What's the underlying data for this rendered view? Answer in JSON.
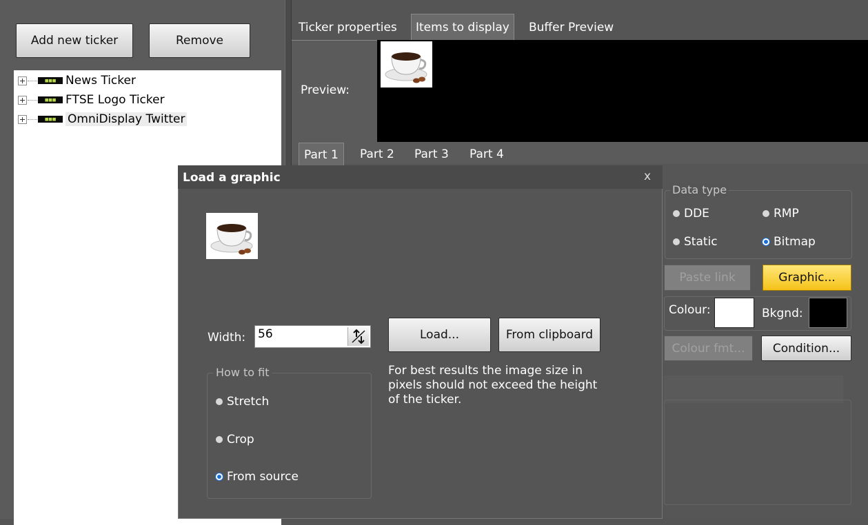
{
  "left_pane": {
    "add_button": "Add new ticker",
    "remove_button": "Remove",
    "tree_items": [
      {
        "label": "News Ticker"
      },
      {
        "label": "FTSE Logo Ticker"
      },
      {
        "label": "OmniDisplay Twitter"
      }
    ]
  },
  "tabs": [
    "Ticker properties",
    "Items to display",
    "Buffer Preview"
  ],
  "preview": {
    "label": "Preview:"
  },
  "parts": [
    "Part 1",
    "Part 2",
    "Part 3",
    "Part 4"
  ],
  "properties": {
    "data_type_legend": "Data type",
    "radios": [
      "DDE",
      "RMP",
      "Static",
      "Bitmap"
    ],
    "paste_link": "Paste link",
    "graphic": "Graphic...",
    "colour_label": "Colour:",
    "bkgnd_label": "Bkgnd:",
    "colour_fmt": "Colour fmt...",
    "condition": "Condition...",
    "colours": {
      "colour": "#ffffff",
      "bkgnd": "#000000",
      "accent": "#f5c218"
    }
  },
  "dialog": {
    "title": "Load a graphic",
    "close": "x",
    "width_label": "Width:",
    "width_value": "56",
    "load_button": "Load...",
    "clipboard_button": "From clipboard",
    "fit_legend": "How to fit",
    "fit_options": [
      "Stretch",
      "Crop",
      "From source"
    ],
    "note": "For best results the image size in pixels should not exceed the height of the ticker."
  }
}
